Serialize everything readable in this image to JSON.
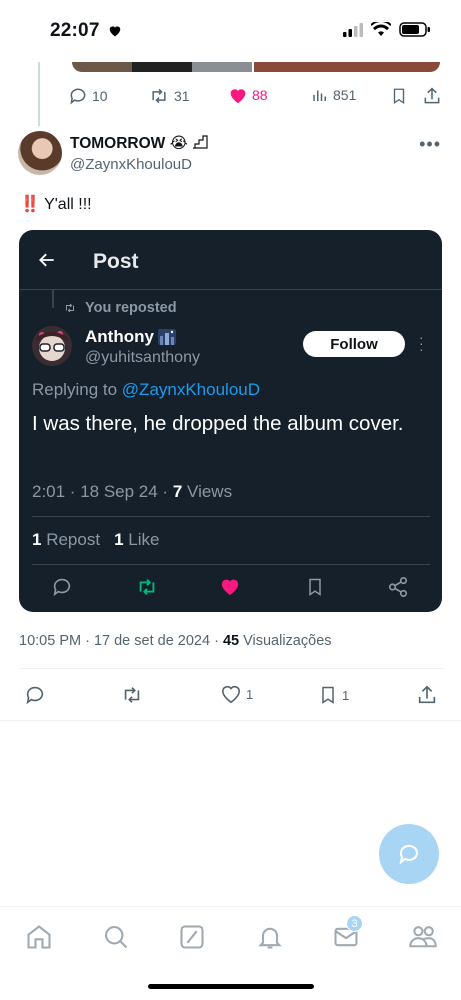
{
  "status_bar": {
    "time": "22:07"
  },
  "previous_tweet": {
    "replies": "10",
    "reposts": "31",
    "likes": "88",
    "views": "851",
    "colors": {
      "like": "#f91880",
      "text": "#536471"
    }
  },
  "tweet": {
    "author_name": "TOMORROW 😭",
    "author_handle": "@ZaynxKhoulouD",
    "text_emoji": "‼️",
    "text": "Y'all !!!"
  },
  "embedded": {
    "header_title": "Post",
    "reposted_label": "You reposted",
    "name": "Anthony",
    "handle": "@yuhitsanthony",
    "follow_label": "Follow",
    "replying_prefix": "Replying to",
    "replying_mention": "@ZaynxKhoulouD",
    "body": "I was there, he dropped the album cover.",
    "meta_time": "2:01 · 18 Sep 24 · ",
    "meta_views_count": "7",
    "meta_views_label": "Views",
    "repost_count": "1",
    "repost_label": "Repost",
    "like_count": "1",
    "like_label": "Like",
    "colors": {
      "bg": "#15202b",
      "accent": "#1d9bf0",
      "retweet": "#00ba7c",
      "like": "#f91880"
    }
  },
  "post_meta": {
    "time": "10:05 PM · 17 de set de 2024 · ",
    "views_count": "45",
    "views_label": "Visualizações"
  },
  "main_actions": {
    "likes": "1",
    "bookmarks": "1"
  },
  "tab_bar": {
    "items": [
      "home-icon",
      "search-icon",
      "grok-icon",
      "notifications-icon",
      "messages-icon",
      "communities-icon"
    ],
    "messages_badge": "3"
  }
}
